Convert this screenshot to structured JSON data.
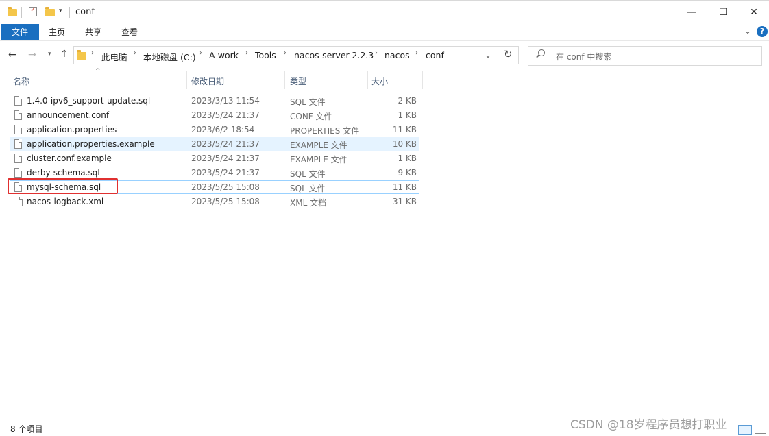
{
  "window": {
    "title": "conf",
    "controls": {
      "minimize": "—",
      "maximize": "☐",
      "close": "✕"
    }
  },
  "ribbon": {
    "tabs": [
      "文件",
      "主页",
      "共享",
      "查看"
    ]
  },
  "navigation": {
    "breadcrumb": [
      "此电脑",
      "本地磁盘 (C:)",
      "A-work",
      "Tools",
      "nacos-server-2.2.3",
      "nacos",
      "conf"
    ],
    "search_placeholder": "在 conf 中搜索"
  },
  "file_list": {
    "columns": [
      "名称",
      "修改日期",
      "类型",
      "大小"
    ],
    "rows": [
      {
        "name": "1.4.0-ipv6_support-update.sql",
        "date": "2023/3/13 11:54",
        "type": "SQL 文件",
        "size": "2 KB"
      },
      {
        "name": "announcement.conf",
        "date": "2023/5/24 21:37",
        "type": "CONF 文件",
        "size": "1 KB"
      },
      {
        "name": "application.properties",
        "date": "2023/6/2 18:54",
        "type": "PROPERTIES 文件",
        "size": "11 KB"
      },
      {
        "name": "application.properties.example",
        "date": "2023/5/24 21:37",
        "type": "EXAMPLE 文件",
        "size": "10 KB"
      },
      {
        "name": "cluster.conf.example",
        "date": "2023/5/24 21:37",
        "type": "EXAMPLE 文件",
        "size": "1 KB"
      },
      {
        "name": "derby-schema.sql",
        "date": "2023/5/24 21:37",
        "type": "SQL 文件",
        "size": "9 KB"
      },
      {
        "name": "mysql-schema.sql",
        "date": "2023/5/25 15:08",
        "type": "SQL 文件",
        "size": "11 KB"
      },
      {
        "name": "nacos-logback.xml",
        "date": "2023/5/25 15:08",
        "type": "XML 文档",
        "size": "31 KB"
      }
    ]
  },
  "status_bar": {
    "item_count": "8 个项目"
  },
  "watermark": "CSDN @18岁程序员想打职业",
  "colors": {
    "file_tab": "#1a6fc0",
    "hover_row": "#e5f3ff",
    "highlight_box": "#e03030"
  }
}
